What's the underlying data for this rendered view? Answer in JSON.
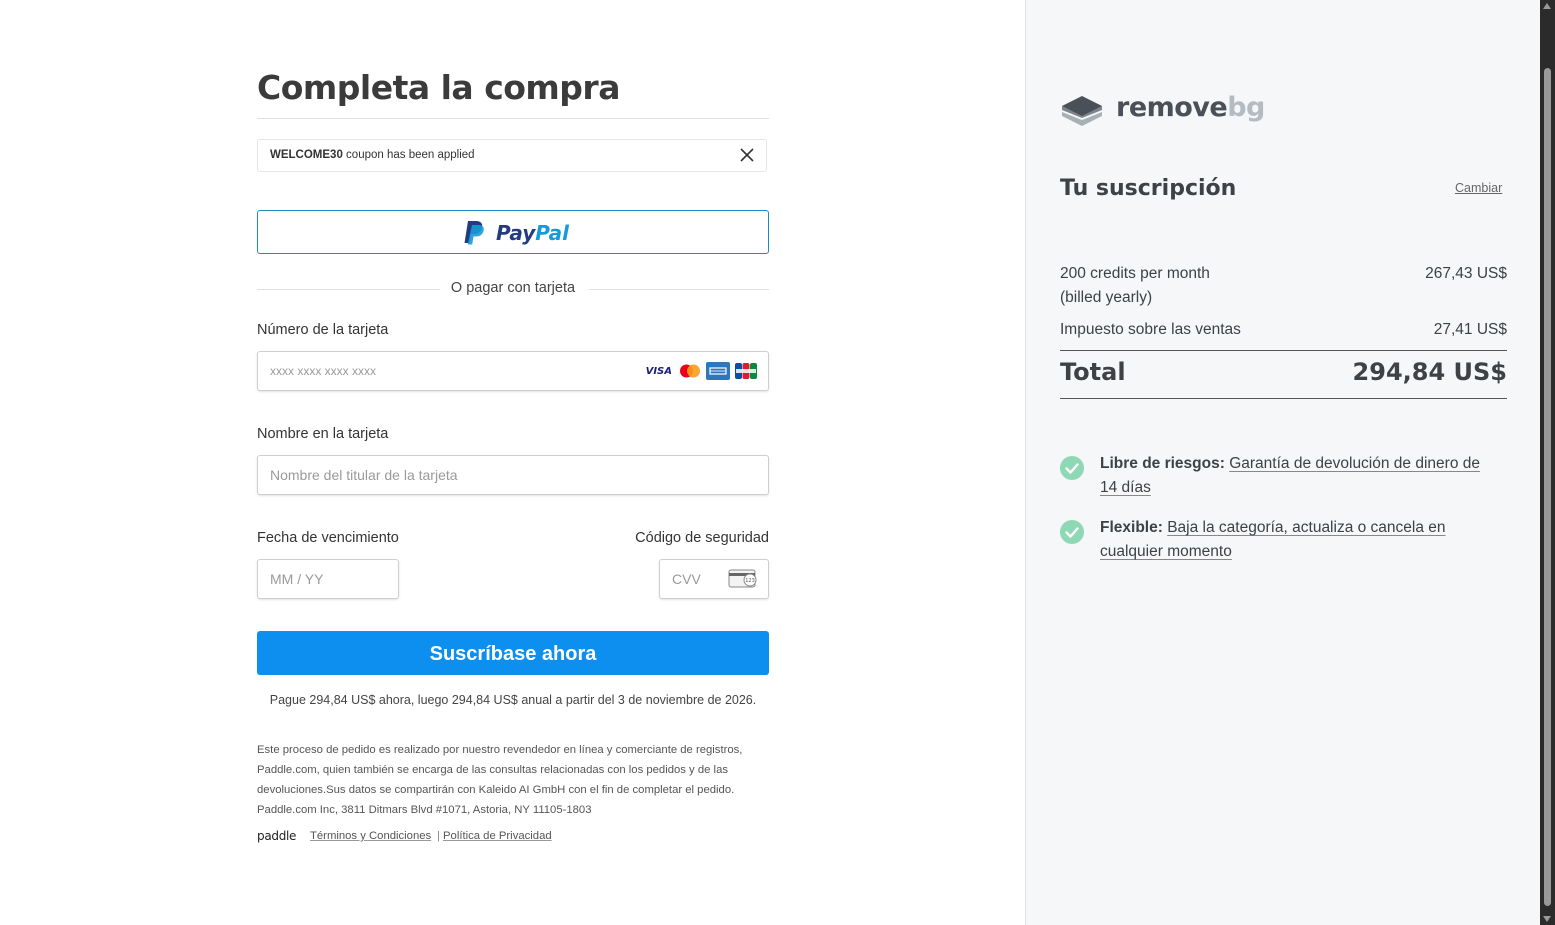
{
  "checkout": {
    "title": "Completa la compra",
    "coupon": {
      "code": "WELCOME30",
      "message": "coupon has been applied"
    },
    "paypal": {
      "pay": "Pay",
      "pal": "Pal"
    },
    "divider_text": "O pagar con tarjeta",
    "card_number": {
      "label": "Número de la tarjeta",
      "placeholder": "xxxx xxxx xxxx xxxx",
      "brands": [
        "visa",
        "mastercard",
        "amex",
        "jcb"
      ],
      "visa_text": "VISA"
    },
    "card_name": {
      "label": "Nombre en la tarjeta",
      "placeholder": "Nombre del titular de la tarjeta"
    },
    "expiry": {
      "label": "Fecha de vencimiento",
      "placeholder": "MM / YY"
    },
    "cvv": {
      "label": "Código de seguridad",
      "placeholder": "CVV",
      "icon_text": "123"
    },
    "submit_label": "Suscríbase ahora",
    "pay_note": "Pague 294,84 US$ ahora, luego 294,84 US$ anual a partir del 3 de noviembre de 2026.",
    "legal_text": "Este proceso de pedido es realizado por nuestro revendedor en línea y comerciante de registros, Paddle.com, quien también se encarga de las consultas relacionadas con los pedidos y de las devoluciones.Sus datos se compartirán con Kaleido AI GmbH con el fin de completar el pedido. Paddle.com Inc, 3811 Ditmars Blvd #1071, Astoria, NY 11105-1803",
    "footer": {
      "paddle": "paddle",
      "terms": "Términos y Condiciones",
      "separator": "|",
      "privacy": "Política de Privacidad"
    }
  },
  "summary": {
    "brand": {
      "remove": "remove",
      "bg": "bg"
    },
    "title": "Tu suscripción",
    "change": "Cambiar",
    "lines": [
      {
        "label_line1": "200 credits per month",
        "label_line2": "(billed yearly)",
        "value": "267,43 US$"
      },
      {
        "label": "Impuesto sobre las ventas",
        "value": "27,41 US$"
      }
    ],
    "total": {
      "label": "Total",
      "value": "294,84 US$"
    },
    "benefits": [
      {
        "strong": "Libre de riesgos:",
        "link": "Garantía de devolución de dinero de 14 días"
      },
      {
        "strong": "Flexible:",
        "link": "Baja la categoría, actualiza o cancela en cualquier momento"
      }
    ]
  },
  "colors": {
    "accent": "#0d8ff0",
    "paypal_border": "#1e88c9",
    "check": "#8fd8b5",
    "panel_bg": "#f5f7f8"
  }
}
